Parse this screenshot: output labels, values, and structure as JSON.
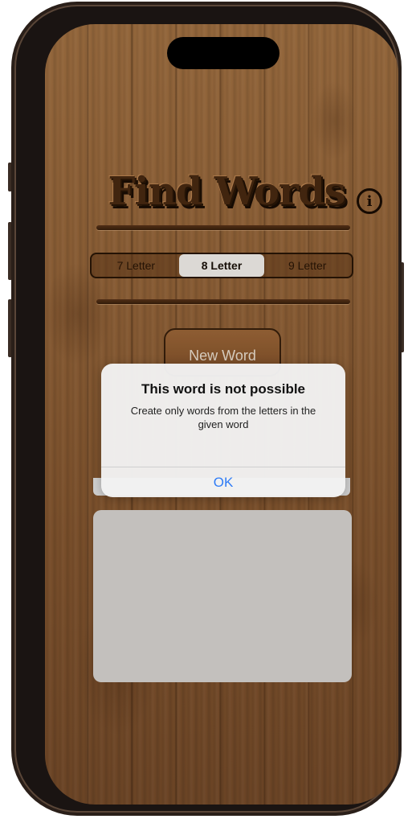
{
  "app": {
    "title": "Find Words",
    "info_icon": "info-icon",
    "info_glyph": "i"
  },
  "segmented": {
    "options": [
      "7 Letter",
      "8 Letter",
      "9 Letter"
    ],
    "selected": "8 Letter"
  },
  "buttons": {
    "new_word": "New Word"
  },
  "alert": {
    "title": "This word is not possible",
    "message": "Create only words from the letters in the given word",
    "ok_label": "OK",
    "ok_color": "#2f7cf6"
  }
}
